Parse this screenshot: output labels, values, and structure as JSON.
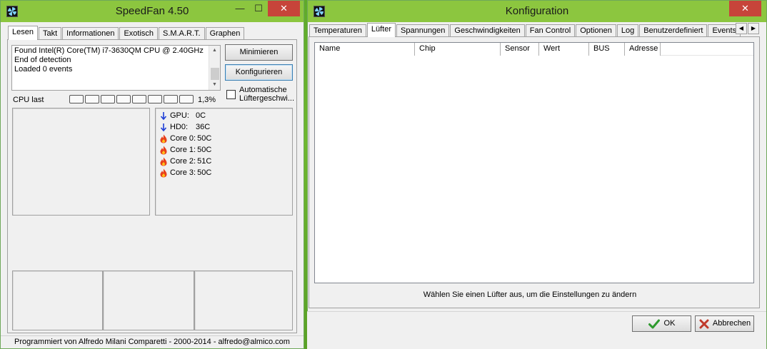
{
  "speedfan": {
    "title": "SpeedFan 4.50",
    "controls": {
      "minimize": "—",
      "maximize": "☐",
      "close": "✕"
    },
    "tabs": [
      {
        "label": "Lesen"
      },
      {
        "label": "Takt"
      },
      {
        "label": "Informationen"
      },
      {
        "label": "Exotisch"
      },
      {
        "label": "S.M.A.R.T."
      },
      {
        "label": "Graphen"
      }
    ],
    "log": [
      "Found Intel(R) Core(TM) i7-3630QM CPU @ 2.40GHz",
      "End of detection",
      "Loaded 0 events"
    ],
    "buttons": {
      "minimize": "Minimieren",
      "configure": "Konfigurieren"
    },
    "auto_fan_label_1": "Automatische",
    "auto_fan_label_2": "Lüftergeschwi...",
    "cpu_label": "CPU last",
    "cpu_percent": "1,3%",
    "sensors": [
      {
        "name": "GPU:",
        "value": "0C",
        "icon": "arrow-down-icon"
      },
      {
        "name": "HD0:",
        "value": "36C",
        "icon": "arrow-down-icon"
      },
      {
        "name": "Core 0:",
        "value": "50C",
        "icon": "flame-icon"
      },
      {
        "name": "Core 1:",
        "value": "50C",
        "icon": "flame-icon"
      },
      {
        "name": "Core 2:",
        "value": "51C",
        "icon": "flame-icon"
      },
      {
        "name": "Core 3:",
        "value": "50C",
        "icon": "flame-icon"
      }
    ],
    "status": "Programmiert von Alfredo Milani Comparetti - 2000-2014 - alfredo@almico.com"
  },
  "config": {
    "title": "Konfiguration",
    "controls": {
      "close": "✕"
    },
    "tabs": [
      {
        "label": "Temperaturen"
      },
      {
        "label": "Lüfter"
      },
      {
        "label": "Spannungen"
      },
      {
        "label": "Geschwindigkeiten"
      },
      {
        "label": "Fan Control"
      },
      {
        "label": "Optionen"
      },
      {
        "label": "Log"
      },
      {
        "label": "Benutzerdefiniert"
      },
      {
        "label": "Events"
      }
    ],
    "tab_scroll": {
      "left": "◀",
      "right": "▶"
    },
    "columns": [
      "Name",
      "Chip",
      "Sensor",
      "Wert",
      "BUS",
      "Adresse"
    ],
    "hint": "Wählen Sie einen Lüfter aus, um die Einstellungen zu ändern",
    "buttons": {
      "ok": "OK",
      "cancel": "Abbrechen"
    }
  },
  "colors": {
    "titlebar": "#8cc63f",
    "close_button": "#c7443a",
    "ok_check": "#2e9a2e",
    "cancel_x": "#c0392b",
    "arrow_blue": "#1f3fd6",
    "flame_red": "#e8401c"
  }
}
